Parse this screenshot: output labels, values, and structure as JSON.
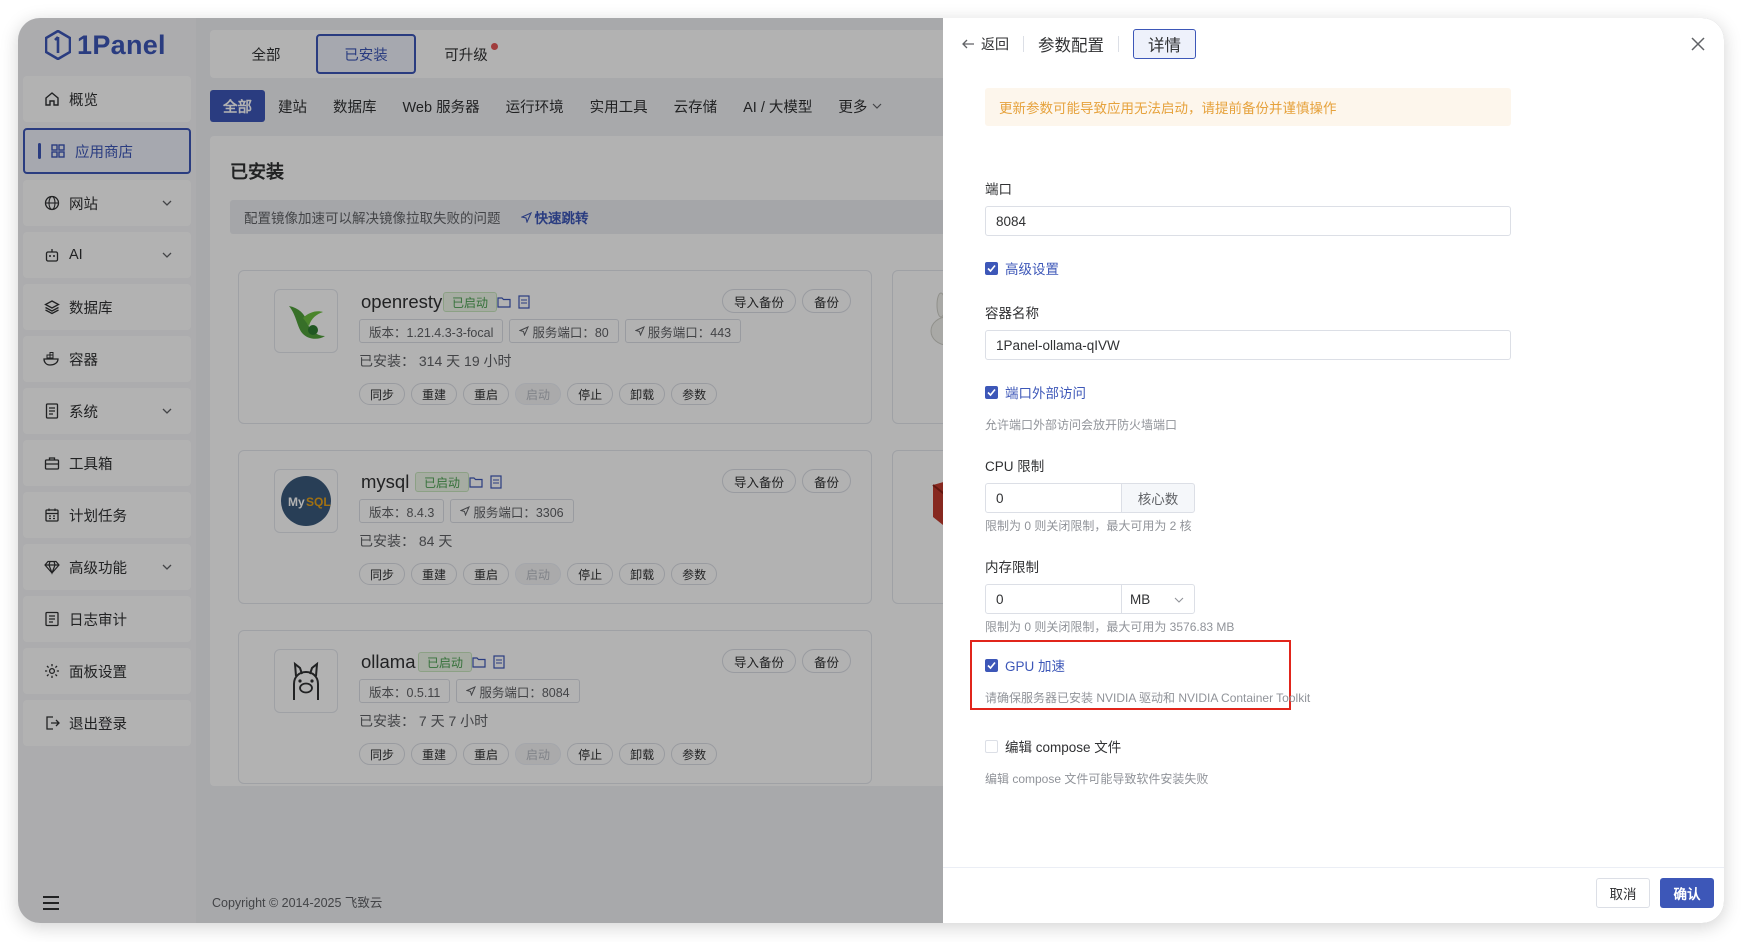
{
  "app": {
    "brand": "1Panel",
    "accent": "#3d57b8"
  },
  "sidebar": {
    "items": [
      {
        "label": "概览",
        "icon": "home-icon"
      },
      {
        "label": "应用商店",
        "icon": "grid-icon",
        "active": true
      },
      {
        "label": "网站",
        "icon": "globe-icon",
        "expandable": true
      },
      {
        "label": "AI",
        "icon": "robot-icon",
        "expandable": true
      },
      {
        "label": "数据库",
        "icon": "layers-icon"
      },
      {
        "label": "容器",
        "icon": "docker-icon"
      },
      {
        "label": "系统",
        "icon": "file-icon",
        "expandable": true
      },
      {
        "label": "工具箱",
        "icon": "toolbox-icon"
      },
      {
        "label": "计划任务",
        "icon": "calendar-icon"
      },
      {
        "label": "高级功能",
        "icon": "diamond-icon",
        "expandable": true
      },
      {
        "label": "日志审计",
        "icon": "log-icon"
      },
      {
        "label": "面板设置",
        "icon": "gear-icon"
      },
      {
        "label": "退出登录",
        "icon": "logout-icon"
      }
    ]
  },
  "status_tabs": [
    "全部",
    "已安装",
    "可升级"
  ],
  "categories": [
    "全部",
    "建站",
    "数据库",
    "Web 服务器",
    "运行环境",
    "实用工具",
    "云存储",
    "AI / 大模型",
    "更多"
  ],
  "content": {
    "title": "已安装",
    "tip": "配置镜像加速可以解决镜像拉取失败的问题",
    "tip_link": "快速跳转"
  },
  "card_actions": {
    "import_backup": "导入备份",
    "backup": "备份"
  },
  "ops": [
    "同步",
    "重建",
    "重启",
    "启动",
    "停止",
    "卸载",
    "参数"
  ],
  "apps": [
    {
      "name": "openresty",
      "status": "已启动",
      "tags": [
        "版本：1.21.4.3-3-focal",
        "服务端口：80",
        "服务端口：443"
      ],
      "installed": "已安装：  314 天 19 小时"
    },
    {
      "name": "mysql",
      "status": "已启动",
      "tags": [
        "版本：8.4.3",
        "服务端口：3306"
      ],
      "installed": "已安装：  84 天"
    },
    {
      "name": "ollama",
      "status": "已启动",
      "tags": [
        "版本：0.5.11",
        "服务端口：8084"
      ],
      "installed": "已安装：  7 天 7 小时"
    }
  ],
  "footer": "Copyright © 2014-2025 飞致云",
  "drawer": {
    "back": "返回",
    "title": "参数配置",
    "detail": "详情",
    "warning": "更新参数可能导致应用无法启动，请提前备份并谨慎操作",
    "port_label": "端口",
    "port_value": "8084",
    "advanced_label": "高级设置",
    "container_label": "容器名称",
    "container_value": "1Panel-ollama-qIVW",
    "external_label": "端口外部访问",
    "external_hint": "允许端口外部访问会放开防火墙端口",
    "cpu_label": "CPU 限制",
    "cpu_value": "0",
    "cpu_unit": "核心数",
    "cpu_hint": "限制为 0 则关闭限制，最大可用为 2 核",
    "mem_label": "内存限制",
    "mem_value": "0",
    "mem_unit": "MB",
    "mem_hint": "限制为 0 则关闭限制，最大可用为 3576.83 MB",
    "gpu_label": "GPU 加速",
    "gpu_hint": "请确保服务器已安装 NVIDIA 驱动和 NVIDIA Container Toolkit",
    "compose_label": "编辑 compose 文件",
    "compose_hint": "编辑 compose 文件可能导致软件安装失败",
    "cancel": "取消",
    "confirm": "确认"
  }
}
